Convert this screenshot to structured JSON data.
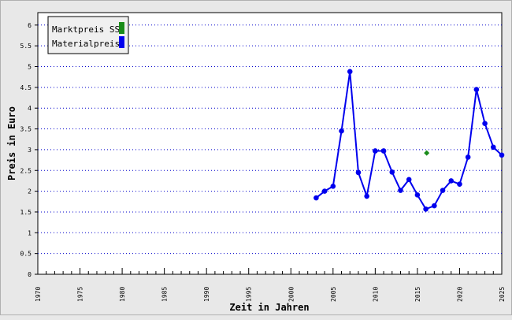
{
  "chart_data": {
    "type": "line",
    "xlabel": "Zeit in Jahren",
    "ylabel": "Preis in Euro",
    "xlim": [
      1970,
      2025
    ],
    "ylim": [
      0,
      6.3
    ],
    "xticks": [
      "1970",
      "1975",
      "1980",
      "1985",
      "1990",
      "1995",
      "2000",
      "2005",
      "2010",
      "2015",
      "2020",
      "2025"
    ],
    "yticks": [
      "0",
      "0.5",
      "1",
      "1.5",
      "2",
      "2.5",
      "3",
      "3.5",
      "4",
      "4.5",
      "5",
      "5.5",
      "6"
    ],
    "grid": "horizontal dotted",
    "legend_position": "top-left",
    "series": [
      {
        "name": "Marktpreis SS",
        "color": "#1a8c1a",
        "style": "marker",
        "x": [
          2016.1
        ],
        "y": [
          2.92
        ]
      },
      {
        "name": "Materialpreis",
        "color": "#0000ee",
        "style": "line-marker",
        "x": [
          2003,
          2004,
          2005,
          2006,
          2007,
          2008,
          2009,
          2010,
          2011,
          2012,
          2013,
          2014,
          2015,
          2016,
          2017,
          2018,
          2019,
          2020,
          2021,
          2022,
          2023,
          2024,
          2025
        ],
        "y": [
          1.84,
          2.0,
          2.12,
          3.45,
          4.88,
          2.45,
          1.88,
          2.97,
          2.97,
          2.46,
          2.02,
          2.28,
          1.91,
          1.57,
          1.65,
          2.02,
          2.25,
          2.17,
          2.82,
          4.45,
          3.63,
          3.06,
          2.87
        ]
      }
    ]
  }
}
